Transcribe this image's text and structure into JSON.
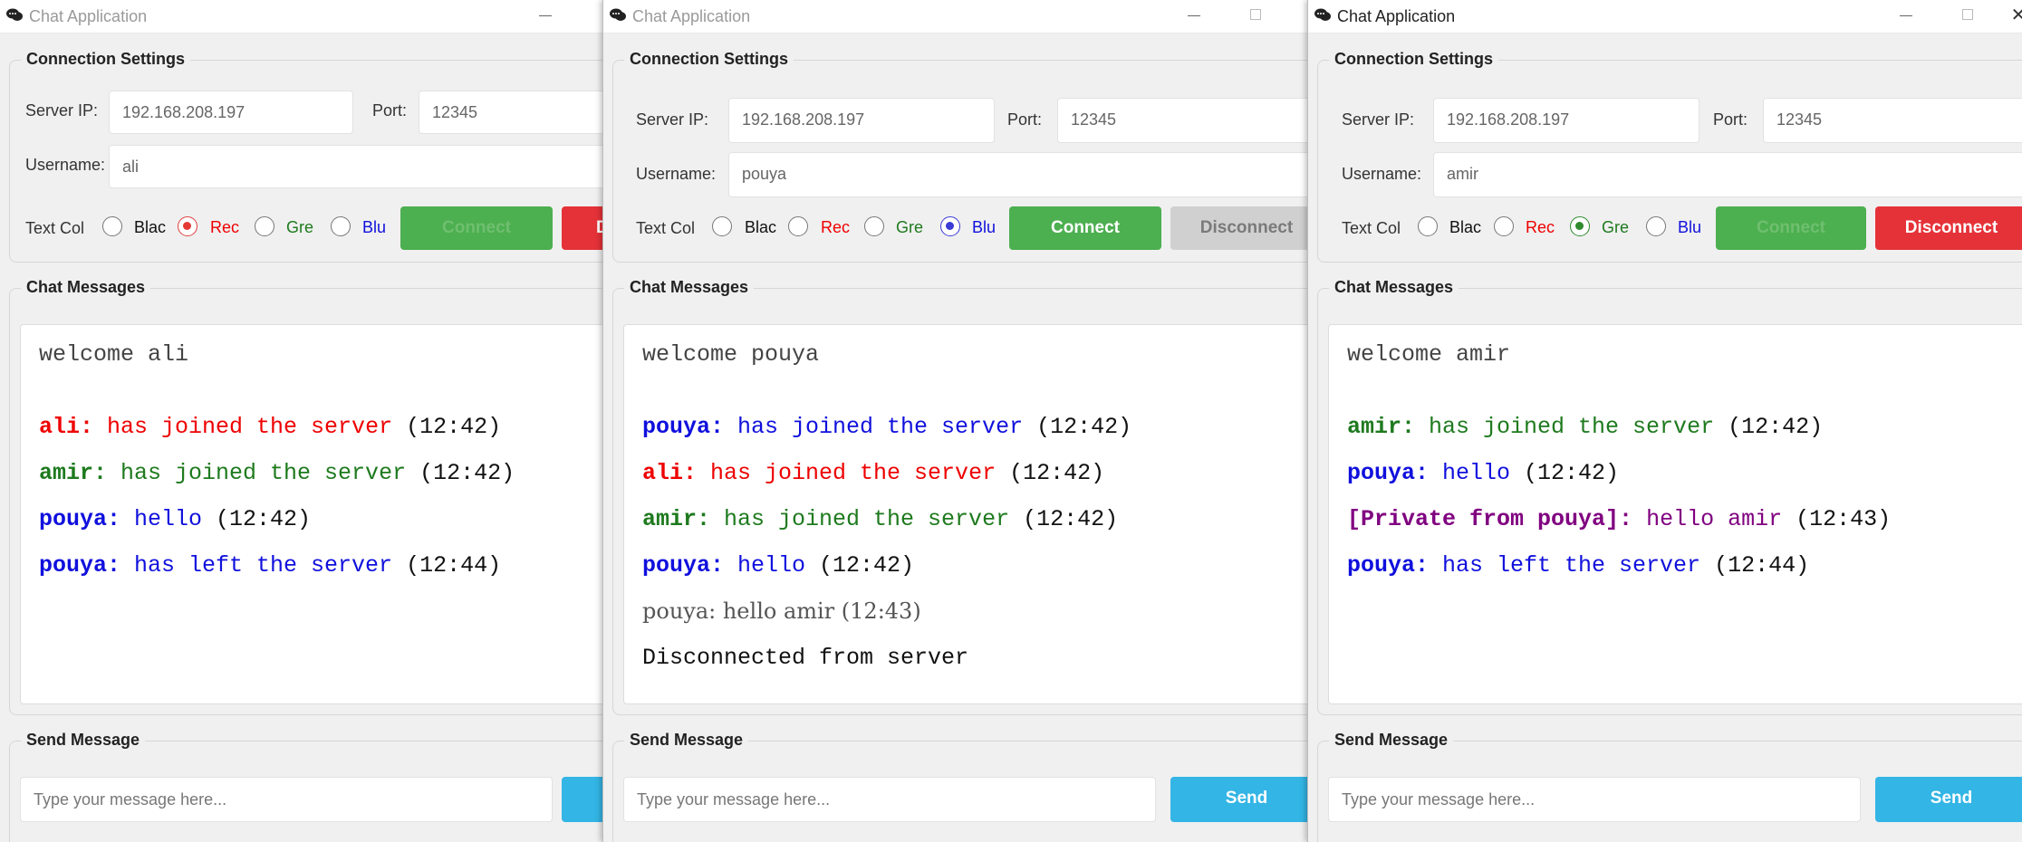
{
  "windows": [
    {
      "title": "Chat Application",
      "connection": {
        "section_title": "Connection Settings",
        "server_ip_label": "Server IP:",
        "server_ip": "192.168.208.197",
        "port_label": "Port:",
        "port": "12345",
        "username_label": "Username:",
        "username": "ali",
        "text_color_label": "Text Col",
        "colors": [
          "Blac",
          "Rec",
          "Gre",
          "Blu"
        ],
        "selected_color": "Red",
        "connect_label": "Connect",
        "disconnect_label": "D"
      },
      "chat": {
        "section_title": "Chat Messages",
        "welcome": "welcome ali",
        "messages": [
          {
            "user": "ali:",
            "text": " has joined the server",
            "time": " (12:42)"
          },
          {
            "user": "amir:",
            "text": " has joined the server",
            "time": " (12:42)"
          },
          {
            "user": "pouya:",
            "text": " hello",
            "time": " (12:42)"
          },
          {
            "user": "pouya:",
            "text": " has left the server",
            "time": " (12:44)"
          }
        ]
      },
      "send": {
        "section_title": "Send Message",
        "placeholder": "Type your message here...",
        "send_label": ""
      }
    },
    {
      "title": "Chat Application",
      "connection": {
        "section_title": "Connection Settings",
        "server_ip_label": "Server IP:",
        "server_ip": "192.168.208.197",
        "port_label": "Port:",
        "port": "12345",
        "username_label": "Username:",
        "username": "pouya",
        "text_color_label": "Text Col",
        "colors": [
          "Blac",
          "Rec",
          "Gre",
          "Blu"
        ],
        "selected_color": "Blue",
        "connect_label": "Connect",
        "disconnect_label": "Disconnect"
      },
      "chat": {
        "section_title": "Chat Messages",
        "welcome": "welcome pouya",
        "messages": [
          {
            "user": "pouya:",
            "text": " has joined the server",
            "time": " (12:42)"
          },
          {
            "user": "ali:",
            "text": " has joined the server",
            "time": " (12:42)"
          },
          {
            "user": "amir:",
            "text": " has joined the server",
            "time": " (12:42)"
          },
          {
            "user": "pouya:",
            "text": " hello",
            "time": " (12:42)"
          },
          {
            "plain": "pouya: hello amir (12:43)"
          },
          {
            "plain": "Disconnected from server"
          }
        ]
      },
      "send": {
        "section_title": "Send Message",
        "placeholder": "Type your message here...",
        "send_label": "Send"
      }
    },
    {
      "title": "Chat Application",
      "connection": {
        "section_title": "Connection Settings",
        "server_ip_label": "Server IP:",
        "server_ip": "192.168.208.197",
        "port_label": "Port:",
        "port": "12345",
        "username_label": "Username:",
        "username": "amir",
        "text_color_label": "Text Col",
        "colors": [
          "Blac",
          "Rec",
          "Gre",
          "Blu"
        ],
        "selected_color": "Green",
        "connect_label": "Connect",
        "disconnect_label": "Disconnect"
      },
      "chat": {
        "section_title": "Chat Messages",
        "welcome": "welcome amir",
        "messages": [
          {
            "user": "amir:",
            "text": " has joined the server",
            "time": " (12:42)"
          },
          {
            "user": "pouya:",
            "text": " hello",
            "time": " (12:42)"
          },
          {
            "user": "[Private from pouya]:",
            "text": " hello amir",
            "time": " (12:43)"
          },
          {
            "user": "pouya:",
            "text": " has left the server",
            "time": " (12:44)"
          }
        ]
      },
      "send": {
        "section_title": "Send Message",
        "placeholder": "Type your message here...",
        "send_label": "Send"
      }
    }
  ],
  "colors": {
    "connect_green": "#4caf50",
    "disconnect_red": "#e53238",
    "send_blue": "#33b5e5",
    "msg_red": "#ee0000",
    "msg_green": "#1e7a1e",
    "msg_blue": "#1010dd",
    "msg_purple": "#800080"
  }
}
